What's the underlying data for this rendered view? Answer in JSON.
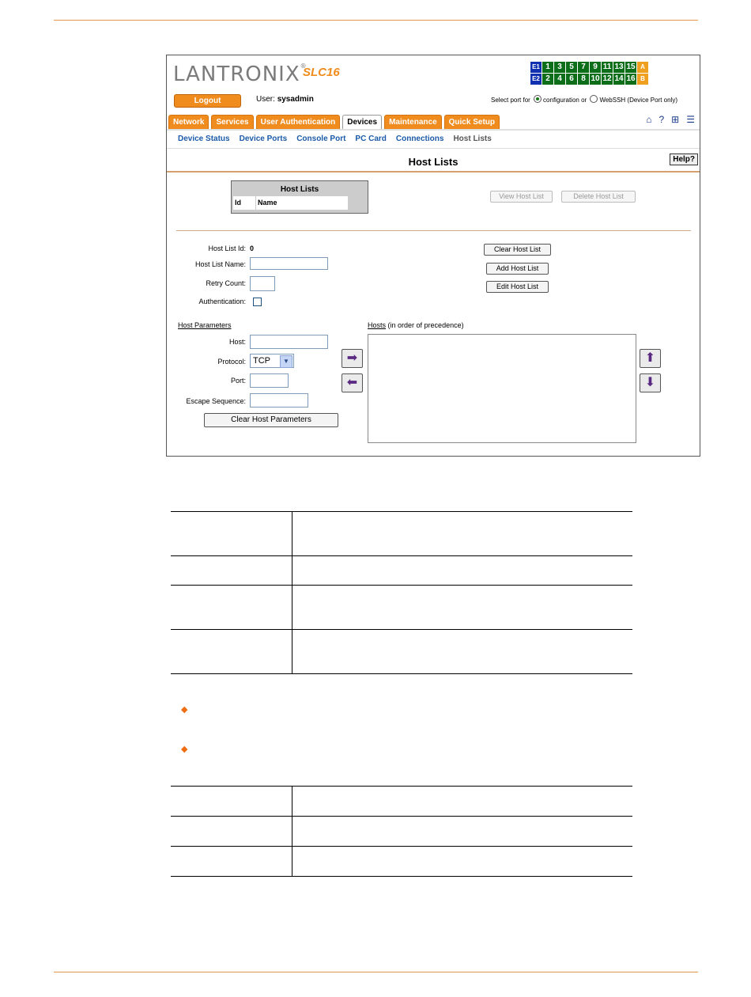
{
  "app": {
    "logo": "LANTRONIX",
    "logo_mark": "®",
    "model": "SLC16"
  },
  "port_grid": {
    "row1_label": "E1",
    "row2_label": "E2",
    "row1_ports": [
      "1",
      "3",
      "5",
      "7",
      "9",
      "11",
      "13",
      "15"
    ],
    "row2_ports": [
      "2",
      "4",
      "6",
      "8",
      "10",
      "12",
      "14",
      "16"
    ],
    "row1_end": "A",
    "row2_end": "B",
    "colors": {
      "port": "#0d6e1a",
      "label": "#1030b0",
      "end": "#f0a020"
    }
  },
  "header": {
    "logout_label": "Logout",
    "user_prefix": "User:",
    "user_name": "sysadmin",
    "select_port_text": "Select port for",
    "option_configuration": "configuration or",
    "option_webssh": "WebSSH (Device Port only)"
  },
  "tabs": [
    "Network",
    "Services",
    "User Authentication",
    "Devices",
    "Maintenance",
    "Quick Setup"
  ],
  "active_tab": "Devices",
  "top_icons": [
    "home-icon",
    "help-icon",
    "sitemap-icon",
    "log-icon"
  ],
  "subnav": [
    "Device Status",
    "Device Ports",
    "Console Port",
    "PC Card",
    "Connections",
    "Host Lists"
  ],
  "page": {
    "title": "Host Lists",
    "help_label": "Help?"
  },
  "host_lists_table": {
    "title": "Host Lists",
    "columns": [
      "Id",
      "Name"
    ]
  },
  "buttons": {
    "view_host_list": "View Host List",
    "delete_host_list": "Delete Host List",
    "clear_host_list": "Clear Host List",
    "add_host_list": "Add Host List",
    "edit_host_list": "Edit Host List",
    "clear_host_parameters": "Clear Host Parameters"
  },
  "form": {
    "host_list_id_label": "Host List Id:",
    "host_list_id_value": "0",
    "host_list_name_label": "Host List Name:",
    "retry_count_label": "Retry Count:",
    "authentication_label": "Authentication:"
  },
  "host_params": {
    "section_title": "Host Parameters",
    "host_label": "Host:",
    "protocol_label": "Protocol:",
    "protocol_value": "TCP",
    "port_label": "Port:",
    "escape_label": "Escape Sequence:"
  },
  "hosts": {
    "title": "Hosts",
    "subtitle": "(in order of precedence)"
  },
  "accent_color": "#f08b1d"
}
